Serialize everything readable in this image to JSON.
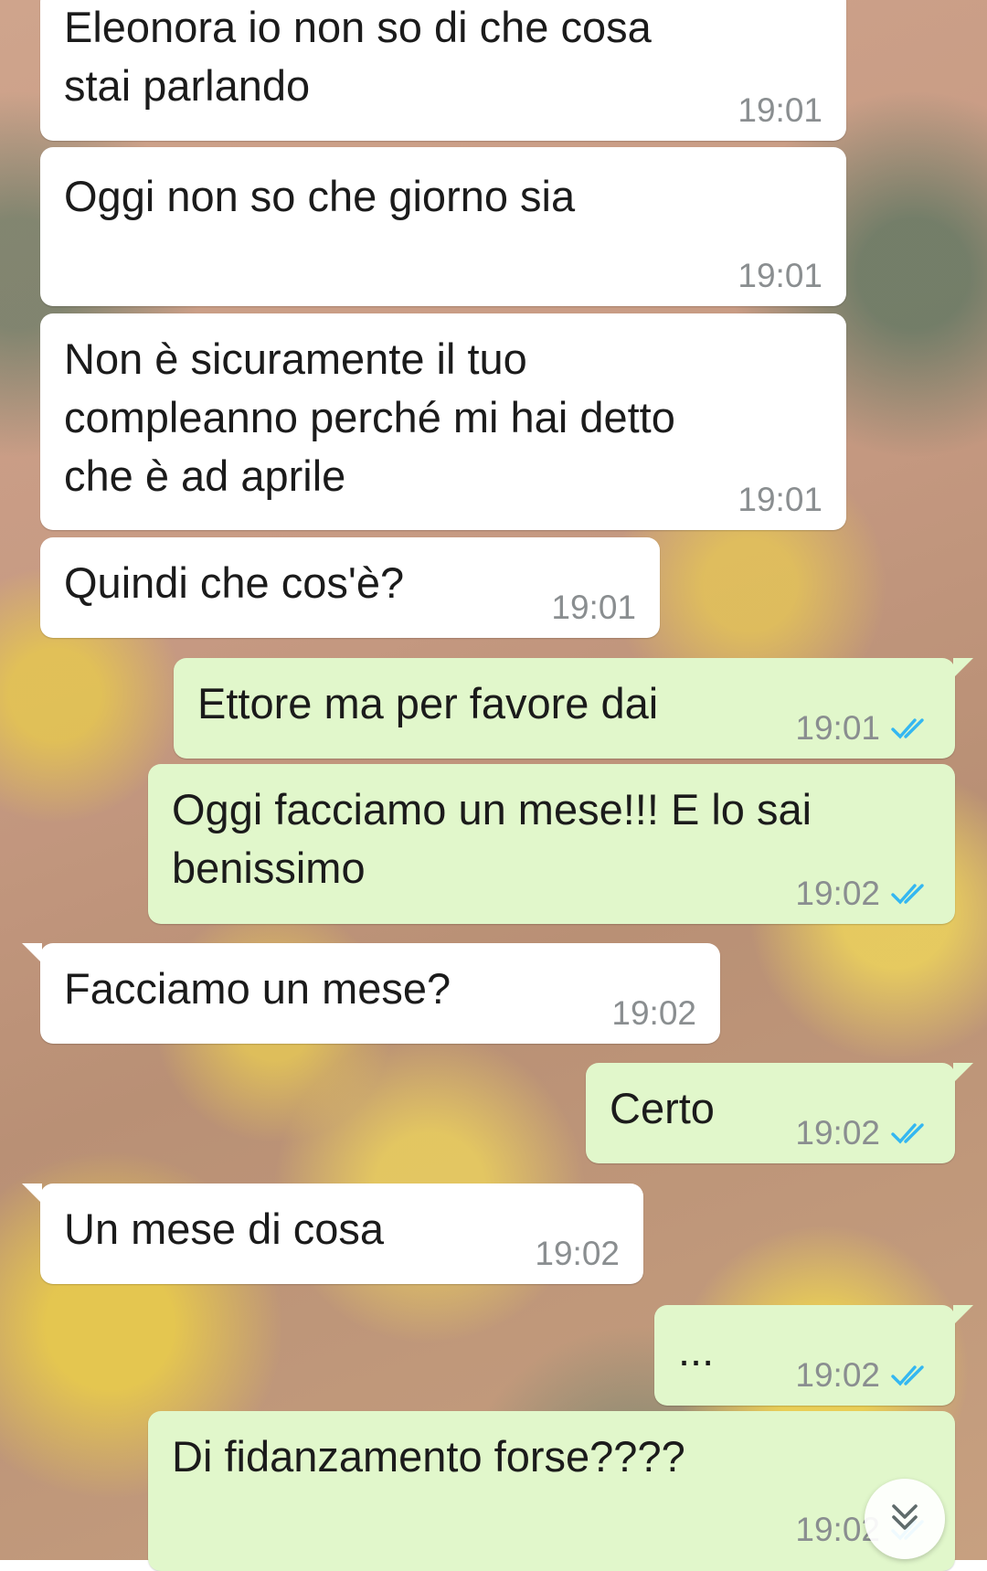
{
  "messages": [
    {
      "direction": "in",
      "text": "Eleonora io non so di che cosa\nstai parlando",
      "time": "19:01"
    },
    {
      "direction": "in",
      "text": "Oggi non so che giorno sia",
      "time": "19:01"
    },
    {
      "direction": "in",
      "text": "Non è sicuramente il tuo\ncompleanno perché mi hai detto\nche è ad aprile",
      "time": "19:01"
    },
    {
      "direction": "in",
      "text": "Quindi che cos'è?",
      "time": "19:01"
    },
    {
      "direction": "out",
      "text": "Ettore ma per favore dai",
      "time": "19:01",
      "status": "read"
    },
    {
      "direction": "out",
      "text": "Oggi facciamo un mese!!! E lo sai\nbenissimo",
      "time": "19:02",
      "status": "read"
    },
    {
      "direction": "in",
      "text": "Facciamo un mese?",
      "time": "19:02"
    },
    {
      "direction": "out",
      "text": "Certo",
      "time": "19:02",
      "status": "read"
    },
    {
      "direction": "in",
      "text": "Un mese di cosa",
      "time": "19:02"
    },
    {
      "direction": "out",
      "text": "...",
      "time": "19:02",
      "status": "read"
    },
    {
      "direction": "out",
      "text": "Di fidanzamento forse????",
      "time": "19:02",
      "status": "read"
    }
  ],
  "icons": {
    "read_receipt": "double-check-icon",
    "scroll_down": "chevron-double-down-icon"
  },
  "colors": {
    "incoming_bubble": "#ffffff",
    "outgoing_bubble": "#e1f7cb",
    "read_tick": "#34b7f1",
    "timestamp": "#8a8e90"
  }
}
